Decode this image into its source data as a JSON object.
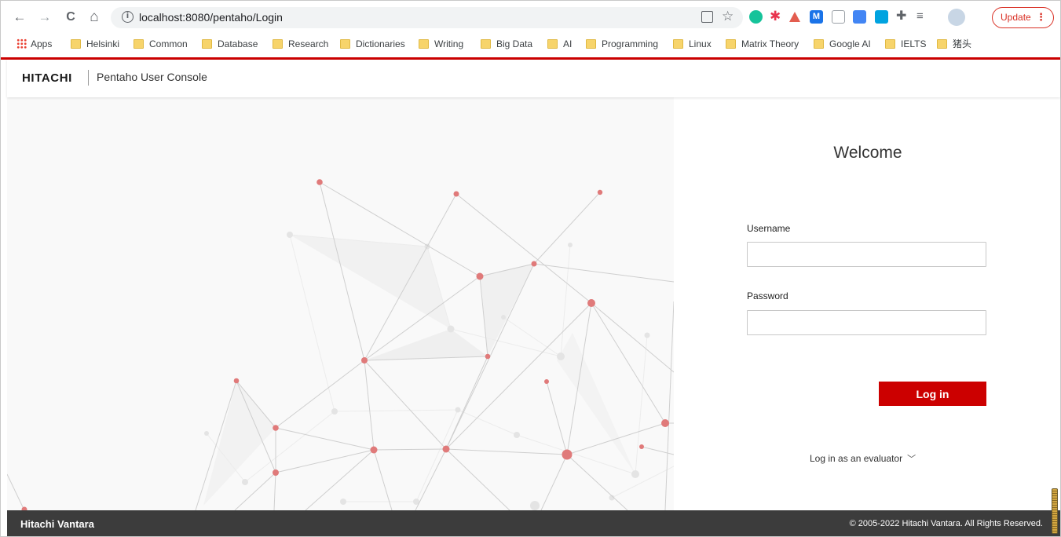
{
  "browser": {
    "url": "localhost:8080/pentaho/Login",
    "update_label": "Update",
    "nav": {
      "back": "←",
      "forward": "→",
      "reload": "C",
      "home": "⌂"
    }
  },
  "bookmarks": [
    {
      "label": "Apps",
      "icon": "apps-grid-icon"
    },
    {
      "label": "Helsinki",
      "icon": "folder-icon"
    },
    {
      "label": "Common",
      "icon": "folder-icon"
    },
    {
      "label": "Database",
      "icon": "folder-icon"
    },
    {
      "label": "Research",
      "icon": "folder-icon"
    },
    {
      "label": "Dictionaries",
      "icon": "folder-icon"
    },
    {
      "label": "Writing",
      "icon": "folder-icon"
    },
    {
      "label": "Big Data",
      "icon": "folder-icon"
    },
    {
      "label": "AI",
      "icon": "folder-icon"
    },
    {
      "label": "Programming",
      "icon": "folder-icon"
    },
    {
      "label": "Linux",
      "icon": "folder-icon"
    },
    {
      "label": "Matrix Theory",
      "icon": "folder-icon"
    },
    {
      "label": "Google AI",
      "icon": "folder-icon"
    },
    {
      "label": "IELTS",
      "icon": "folder-icon"
    },
    {
      "label": "猪头",
      "icon": "folder-icon"
    }
  ],
  "header": {
    "logo": "HITACHI",
    "title": "Pentaho User Console"
  },
  "login": {
    "welcome": "Welcome",
    "username_label": "Username",
    "username_value": "",
    "password_label": "Password",
    "password_value": "",
    "login_button": "Log in",
    "evaluator_link": "Log in as an evaluator",
    "evaluator_chevron": "﹀"
  },
  "footer": {
    "brand": "Hitachi Vantara",
    "copyright": "© 2005-2022 Hitachi Vantara. All Rights Reserved."
  },
  "colors": {
    "accent": "#cc0000",
    "footer_bg": "#3c3c3c",
    "node": "#e07a7a"
  }
}
